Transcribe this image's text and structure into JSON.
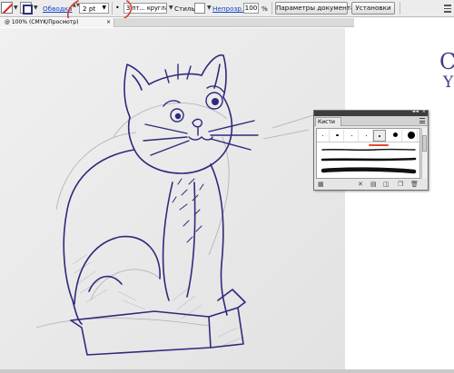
{
  "control_bar": {
    "stroke_link": "Обводка",
    "weight": "2 pt",
    "brush_preset": "3 пт... круглая",
    "style_label": "Стиль:",
    "opacity_link": "Непрозр.:",
    "opacity_value": "100",
    "percent": "%",
    "doc_settings": "Параметры документа",
    "preferences": "Установки",
    "weight_arrows": "▲▼",
    "chevron": "▼",
    "profile_glyph": "•"
  },
  "document_tab": {
    "label": "@ 100% (CMYK/Просмотр)",
    "close": "×"
  },
  "brushes_panel": {
    "tab": "Кисти",
    "collapse_arrows": "◄◄",
    "close": "×",
    "preset_sizes": [
      1,
      2,
      3,
      4,
      5,
      6,
      7
    ],
    "selected_preset": 4
  },
  "handwriting": {
    "c": "C",
    "y": "Y"
  },
  "colors": {
    "ink": "#2e2a7c",
    "pencil": "#9a9a9a",
    "annotation_red": "#d63a2a",
    "panel_header": "#3d3d3d"
  }
}
